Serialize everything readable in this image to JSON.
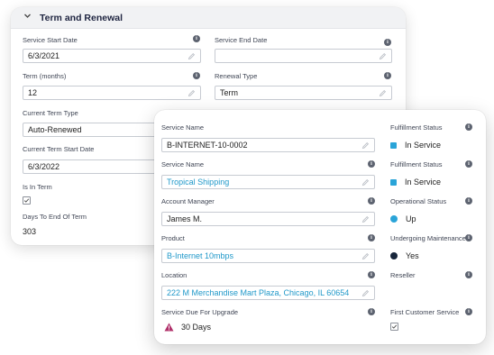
{
  "back_card": {
    "section_title": "Term and Renewal",
    "service_start_date": {
      "label": "Service Start Date",
      "value": "6/3/2021"
    },
    "service_end_date": {
      "label": "Service End Date",
      "value": ""
    },
    "term_months": {
      "label": "Term (months)",
      "value": "12"
    },
    "renewal_type": {
      "label": "Renewal Type",
      "value": "Term"
    },
    "current_term_type": {
      "label": "Current Term Type",
      "value": "Auto-Renewed"
    },
    "current_term_start_date": {
      "label": "Current Term Start Date",
      "value": "6/3/2022"
    },
    "is_in_term": {
      "label": "Is In Term",
      "checked": true
    },
    "days_to_end_of_term": {
      "label": "Days To End Of Term",
      "value": "303"
    }
  },
  "front_card": {
    "service_name_1": {
      "label": "Service Name",
      "value": "B-INTERNET-10-0002"
    },
    "service_name_2": {
      "label": "Service Name",
      "value": "Tropical Shipping"
    },
    "account_manager": {
      "label": "Account Manager",
      "value": "James M."
    },
    "product": {
      "label": "Product",
      "value": "B-Internet 10mbps"
    },
    "location": {
      "label": "Location",
      "value": "222 M Merchandise Mart Plaza, Chicago, IL 60654"
    },
    "service_due_for_upgrade": {
      "label": "Service Due For Upgrade",
      "value": "30 Days"
    },
    "fulfillment_status_1": {
      "label": "Fulfillment Status",
      "value": "In Service"
    },
    "fulfillment_status_2": {
      "label": "Fulfillment Status",
      "value": "In Service"
    },
    "operational_status": {
      "label": "Operational Status",
      "value": "Up"
    },
    "undergoing_maintenance": {
      "label": "Undergoing Maintenance",
      "value": "Yes"
    },
    "reseller": {
      "label": "Reseller",
      "value": ""
    },
    "first_customer_service": {
      "label": "First Customer Service",
      "checked": true
    }
  },
  "colors": {
    "link": "#1f98c9",
    "status_blue": "#2aa4d8",
    "status_navy": "#17253b",
    "warning": "#b0306a"
  },
  "icons": [
    "chevron-down-icon",
    "info-icon",
    "pencil-icon",
    "checkmark-icon",
    "warning-icon"
  ]
}
